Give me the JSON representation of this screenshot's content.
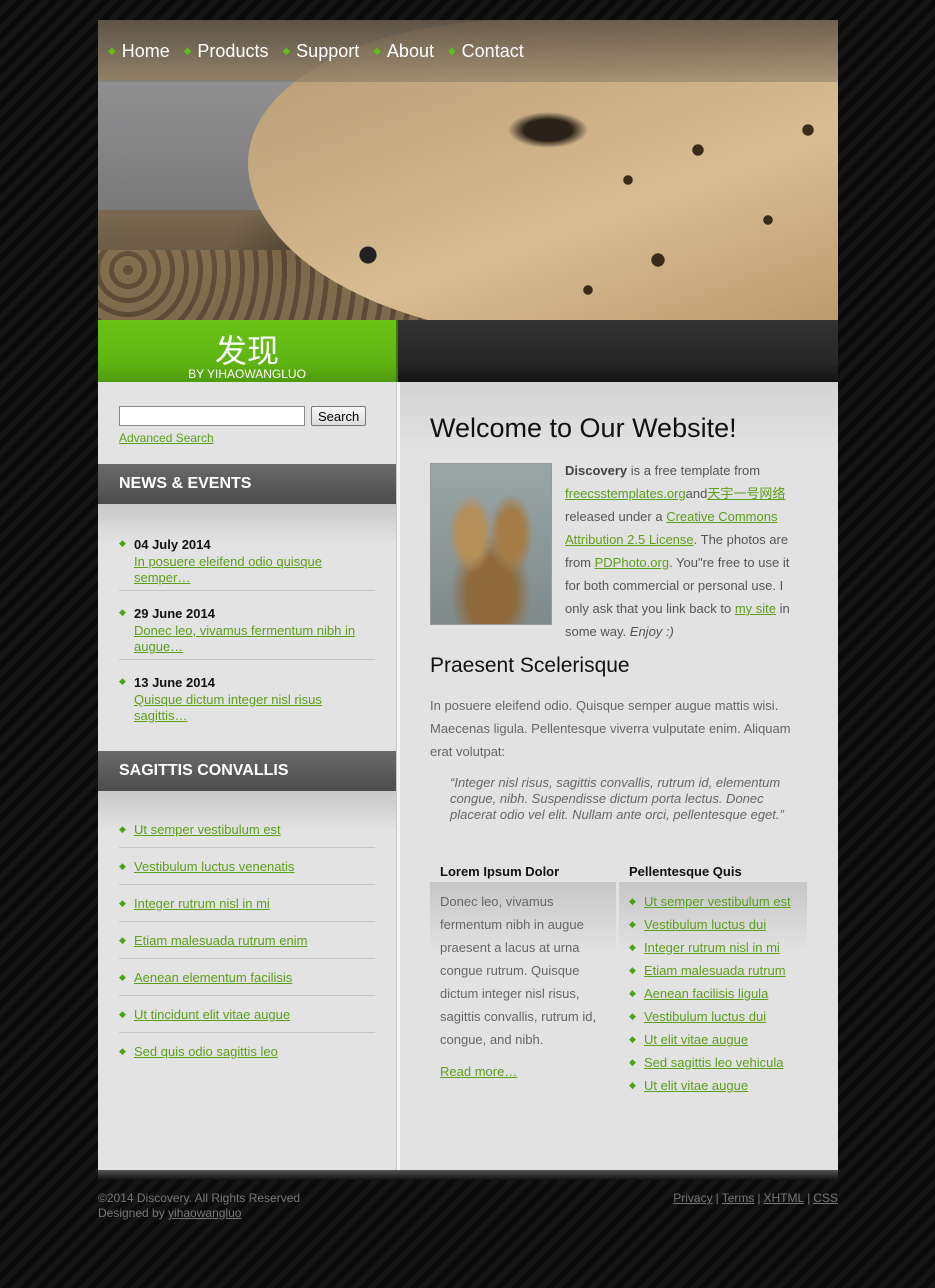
{
  "nav": {
    "items": [
      {
        "label": "Home"
      },
      {
        "label": "Products"
      },
      {
        "label": "Support"
      },
      {
        "label": "About"
      },
      {
        "label": "Contact"
      }
    ]
  },
  "logo": {
    "title": "发现",
    "byline": "BY YIHAOWANGLUO"
  },
  "search": {
    "button_label": "Search",
    "value": "",
    "advanced_label": "Advanced Search"
  },
  "news": {
    "heading": "NEWS & EVENTS",
    "items": [
      {
        "date": "04 July 2014",
        "text": "In posuere eleifend odio quisque semper…"
      },
      {
        "date": "29 June 2014",
        "text": "Donec leo, vivamus fermentum nibh in augue…"
      },
      {
        "date": "13 June 2014",
        "text": "Quisque dictum integer nisl risus sagittis…"
      }
    ]
  },
  "sagittis": {
    "heading": "SAGITTIS CONVALLIS",
    "links": [
      "Ut semper vestibulum est",
      "Vestibulum luctus venenatis",
      "Integer rutrum nisl in mi",
      "Etiam malesuada rutrum enim",
      "Aenean elementum facilisis",
      "Ut tincidunt elit vitae augue",
      "Sed quis odio sagittis leo"
    ]
  },
  "main": {
    "welcome_title": "Welcome to Our Website!",
    "intro": {
      "brand": "Discovery",
      "t1": " is a free template from ",
      "link1": "freecsstemplates.org",
      "t2": "and",
      "link2": "天宇一号网络",
      "t3": " released under a ",
      "link3": "Creative Commons Attribution 2.5 License",
      "t4": ". The photos are from ",
      "link4": "PDPhoto.org",
      "t5": ". You\"re free to use it for both commercial or personal use. I only ask that you link back to ",
      "link5": "my site",
      "t6": " in some way. ",
      "enjoy": "Enjoy :)"
    },
    "subheading": "Praesent Scelerisque",
    "paragraph": "In posuere eleifend odio. Quisque semper augue mattis wisi. Maecenas ligula. Pellentesque viverra vulputate enim. Aliquam erat volutpat:",
    "quote": "“Integer nisl risus, sagittis convallis, rutrum id, elementum congue, nibh. Suspendisse dictum porta lectus. Donec placerat odio vel elit. Nullam ante orci, pellentesque eget.”",
    "col1": {
      "title": "Lorem Ipsum Dolor",
      "text": "Donec leo, vivamus fermentum nibh in augue praesent a lacus at urna congue rutrum. Quisque dictum integer nisl risus, sagittis convallis, rutrum id, congue, and nibh.",
      "read_more": "Read more…"
    },
    "col2": {
      "title": "Pellentesque Quis",
      "links": [
        "Ut semper vestibulum est",
        "Vestibulum luctus dui",
        "Integer rutrum nisl in mi",
        "Etiam malesuada rutrum",
        "Aenean facilisis ligula",
        "Vestibulum luctus dui",
        "Ut elit vitae augue",
        "Sed sagittis leo vehicula",
        "Ut elit vitae augue"
      ]
    }
  },
  "footer": {
    "copyright": "©2014 Discovery. All Rights Reserved",
    "designed_by": "Designed by ",
    "designer": "yihaowangluo",
    "links": [
      "Privacy",
      "Terms",
      "XHTML",
      "CSS"
    ]
  },
  "colors": {
    "accent_green": "#5fb412",
    "link_green": "#5c9f1b",
    "nav_bullet": "#62bd18"
  },
  "icons": {
    "nav_bullet": "arrow-right-icon",
    "list_bullet": "arrow-right-icon"
  }
}
